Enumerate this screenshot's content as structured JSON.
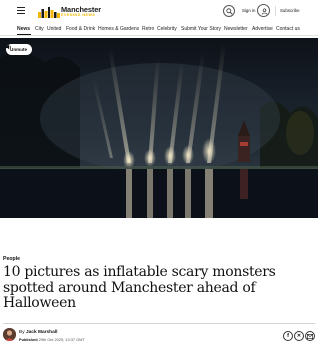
{
  "header": {
    "logo_word": "Manchester",
    "logo_sub": "EVENING NEWS",
    "signin_label": "Sign in",
    "subscribe_label": "Subscribe"
  },
  "nav": {
    "items": [
      {
        "label": "News"
      },
      {
        "label": "City"
      },
      {
        "label": "United"
      },
      {
        "label": "Food & Drink"
      },
      {
        "label": "Homes & Gardens"
      },
      {
        "label": "Retro"
      },
      {
        "label": "Celebrity"
      },
      {
        "label": "Submit Your Story"
      },
      {
        "label": "Newsletter"
      },
      {
        "label": "Advertise"
      },
      {
        "label": "Contact us"
      }
    ]
  },
  "video": {
    "unmute_label": "Unmute"
  },
  "article": {
    "category": "People",
    "headline": "10 pictures as inflatable scary monsters spotted around Manchester ahead of Halloween",
    "author_prefix": "By",
    "author_name": "Jack Marshall",
    "published_label": "Published",
    "published_date": "29th Oct 2025, 13:37 GMT"
  },
  "colors": {
    "brand_yellow": "#f2b705",
    "text": "#111111"
  }
}
